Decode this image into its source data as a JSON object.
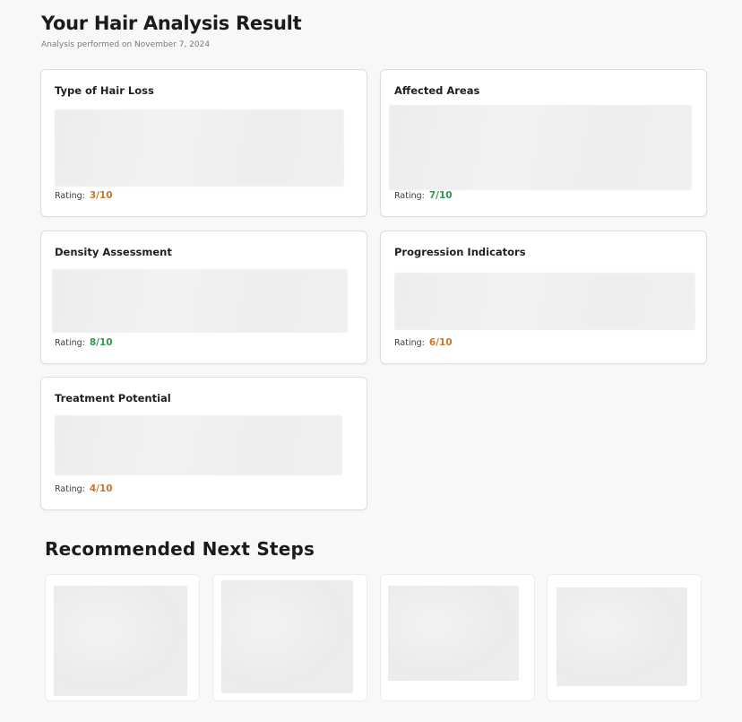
{
  "header": {
    "title": "Your Hair Analysis Result",
    "subtitle": "Analysis performed on November 7, 2024"
  },
  "colors": {
    "rating_low": "#c8762c",
    "rating_high": "#2e9a4d"
  },
  "cards": [
    {
      "title": "Type of Hair Loss",
      "rating_label": "Rating:",
      "rating_value": "3/10",
      "level": "low"
    },
    {
      "title": "Affected Areas",
      "rating_label": "Rating:",
      "rating_value": "7/10",
      "level": "high"
    },
    {
      "title": "Density Assessment",
      "rating_label": "Rating:",
      "rating_value": "8/10",
      "level": "high"
    },
    {
      "title": "Progression Indicators",
      "rating_label": "Rating:",
      "rating_value": "6/10",
      "level": "low"
    },
    {
      "title": "Treatment Potential",
      "rating_label": "Rating:",
      "rating_value": "4/10",
      "level": "low"
    }
  ],
  "next_steps": {
    "title": "Recommended Next Steps"
  }
}
